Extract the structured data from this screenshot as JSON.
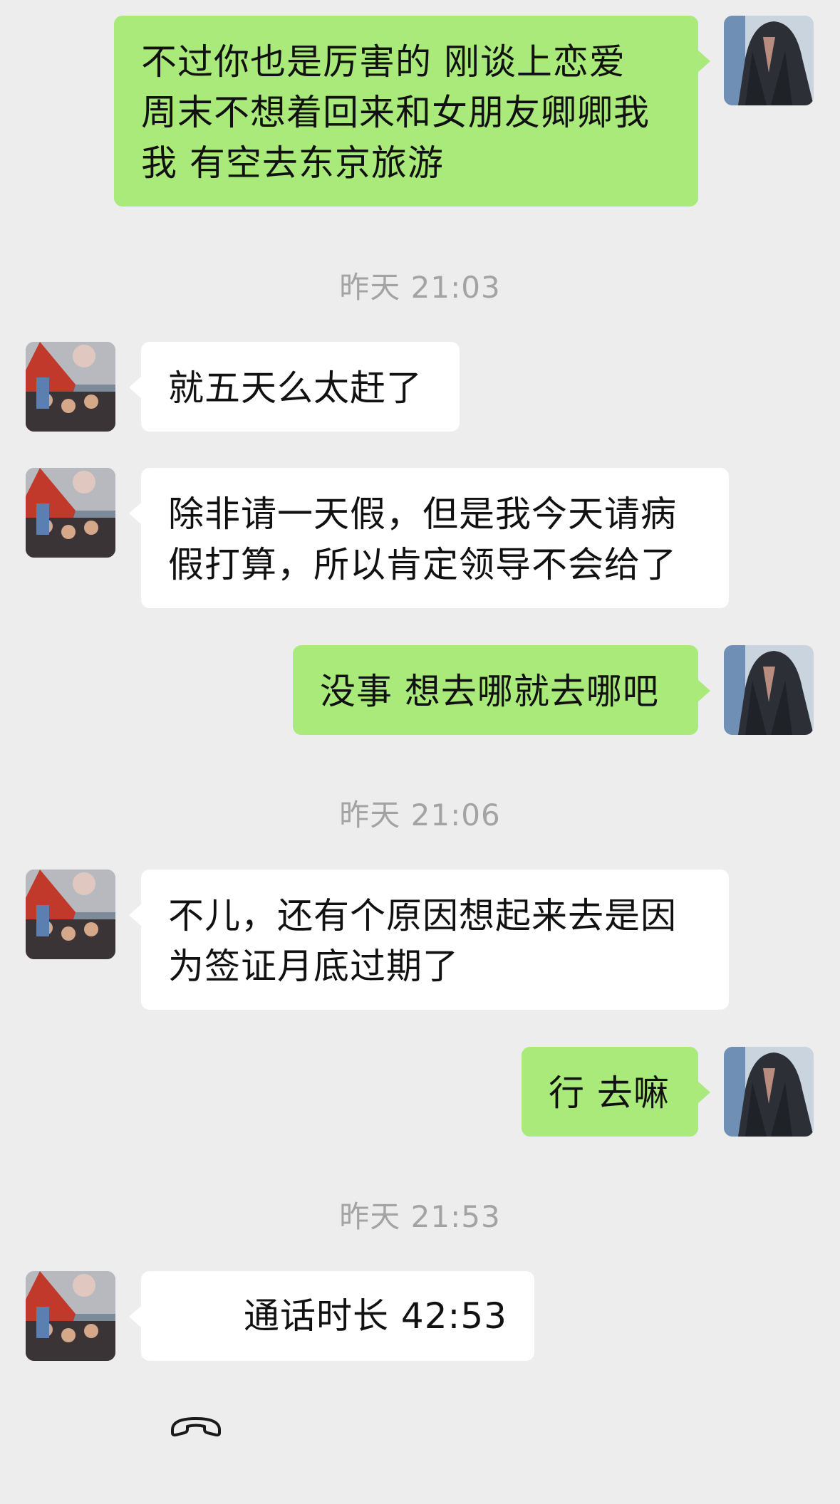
{
  "messages": [
    {
      "sender": "self",
      "text": "不过你也是厉害的 刚谈上恋爱\n周末不想着回来和女朋友卿卿我\n我 有空去东京旅游"
    },
    {
      "timestamp": "昨天 21:03"
    },
    {
      "sender": "other",
      "text": "就五天么太赶了"
    },
    {
      "sender": "other",
      "text": "除非请一天假，但是我今天请病\n假打算，所以肯定领导不会给了"
    },
    {
      "sender": "self",
      "text": "没事 想去哪就去哪吧"
    },
    {
      "timestamp": "昨天 21:06"
    },
    {
      "sender": "other",
      "text": "不儿，还有个原因想起来去是因\n为签证月底过期了"
    },
    {
      "sender": "self",
      "text": "行 去嘛"
    },
    {
      "timestamp": "昨天 21:53"
    },
    {
      "sender": "other",
      "type": "call",
      "icon": "phone-hangup-icon",
      "text": "通话时长 42:53"
    }
  ],
  "colors": {
    "background": "#ededed",
    "self_bubble": "#a9ea7a",
    "other_bubble": "#ffffff",
    "timestamp_text": "#a3a3a3"
  }
}
